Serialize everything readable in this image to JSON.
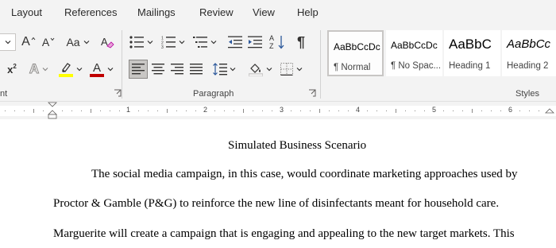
{
  "tabs": [
    {
      "label": "Layout"
    },
    {
      "label": "References"
    },
    {
      "label": "Mailings"
    },
    {
      "label": "Review"
    },
    {
      "label": "View"
    },
    {
      "label": "Help"
    }
  ],
  "ribbon": {
    "font": {
      "grow_label": "A",
      "shrink_label": "A",
      "case_label": "Aa",
      "superscript_label": "x",
      "superscript_exp": "2",
      "text_effects_label": "A",
      "highlight_color": "#ffff00",
      "font_color_label": "A",
      "font_color": "#c00000"
    },
    "paragraph": {
      "sort_label": "A",
      "sort_label2": "Z",
      "pilcrow": "¶"
    },
    "groups": {
      "font_label_fragment": "nt",
      "paragraph_label": "Paragraph",
      "styles_label": "Styles"
    },
    "styles": [
      {
        "preview": "AaBbCcDc",
        "name": "¶ Normal",
        "selected": true
      },
      {
        "preview": "AaBbCcDc",
        "name": "¶ No Spac..."
      },
      {
        "preview": "AaBbC",
        "name": "Heading 1"
      },
      {
        "preview": "AaBbCc",
        "name": "Heading 2"
      }
    ]
  },
  "ruler": {
    "numbers": [
      "1",
      "2",
      "3",
      "4",
      "5",
      "6"
    ]
  },
  "document": {
    "title": "Simulated Business Scenario",
    "lines": [
      "The social media campaign, in this case, would coordinate marketing approaches used by",
      "Proctor & Gamble (P&G) to reinforce the new line of disinfectants meant for household care.",
      "Marguerite will create a campaign that is engaging and appealing to the new target markets. This"
    ]
  },
  "colors": {
    "ribbon_bg": "#f3f3f3",
    "accent": "#2b579a"
  }
}
